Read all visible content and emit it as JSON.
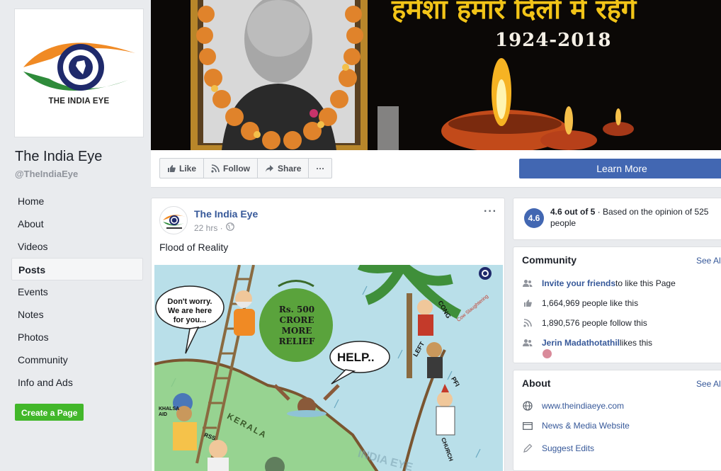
{
  "left": {
    "logo_text": "THE INDIA EYE",
    "page_name": "The India Eye",
    "page_handle": "@TheIndiaEye",
    "nav": [
      {
        "label": "Home",
        "active": false
      },
      {
        "label": "About",
        "active": false
      },
      {
        "label": "Videos",
        "active": false
      },
      {
        "label": "Posts",
        "active": true
      },
      {
        "label": "Events",
        "active": false
      },
      {
        "label": "Notes",
        "active": false
      },
      {
        "label": "Photos",
        "active": false
      },
      {
        "label": "Community",
        "active": false
      },
      {
        "label": "Info and Ads",
        "active": false
      }
    ],
    "create_page_label": "Create a Page"
  },
  "cover": {
    "hindi_text": "हमेशा हमारे दिलों में रहेंगे",
    "years": "1924-2018"
  },
  "action_bar": {
    "like_label": "Like",
    "follow_label": "Follow",
    "share_label": "Share",
    "more_label": "···",
    "learn_more_label": "Learn More"
  },
  "post": {
    "author": "The India Eye",
    "time": "22 hrs ·",
    "text": "Flood of Reality",
    "menu": "···",
    "cartoon": {
      "bubble_worry": "Don't worry. We are here for you...",
      "sack_text": "Rs. 500 CRORE MORE RELIEF",
      "help_text": "HELP..",
      "kerala_label": "KERALA",
      "left_label": "LEFT",
      "cong_label": "CONG",
      "cow_label": "Cow Slaughtering",
      "church_label": "CHURCH",
      "pfi_label": "PFI",
      "rss_label": "RSS",
      "khalsa_label": "KHALSA AID",
      "watermark": "INDIA EYE"
    }
  },
  "rating": {
    "badge": "4.6",
    "score": "4.6 out of 5",
    "detail": " · Based on the opinion of 525 people"
  },
  "community": {
    "title": "Community",
    "see_all": "See All",
    "invite_link": "Invite your friends",
    "invite_rest": " to like this Page",
    "likes": "1,664,969 people like this",
    "follows": "1,890,576 people follow this",
    "friend_name": "Jerin Madathotathil",
    "friend_rest": " likes this"
  },
  "about": {
    "title": "About",
    "see_all": "See All",
    "website": "www.theindiaeye.com",
    "category": "News & Media Website",
    "suggest": "Suggest Edits"
  },
  "colors": {
    "brand_blue": "#4267b2",
    "link_blue": "#365899",
    "green": "#42b72a",
    "background": "#e9ebee",
    "logo_saffron": "#f08a24",
    "logo_green": "#2e8b3a",
    "logo_navy": "#1f2a6b"
  }
}
